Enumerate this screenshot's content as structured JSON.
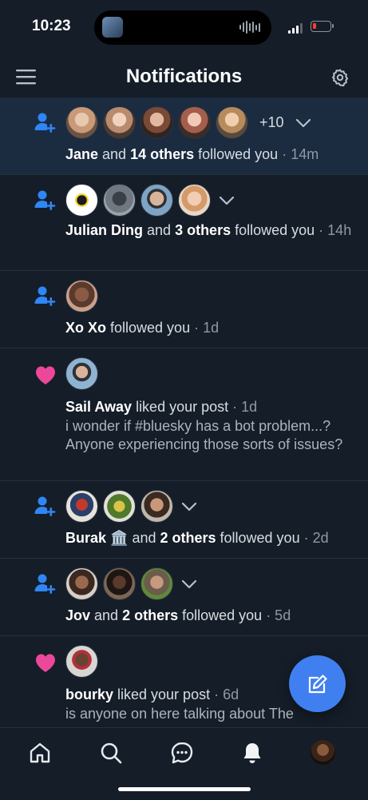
{
  "status_bar": {
    "time": "10:23"
  },
  "header": {
    "title": "Notifications"
  },
  "notifications": [
    {
      "type": "follow",
      "avatars": 5,
      "more": "+10",
      "actor": "Jane",
      "connector": " and ",
      "others": "14 others",
      "action": " followed you",
      "time": " · 14m"
    },
    {
      "type": "follow",
      "avatars": 4,
      "actor": "Julian Ding",
      "connector": " and ",
      "others": "3 others",
      "action": " followed you",
      "time": " · 14h"
    },
    {
      "type": "follow",
      "avatars": 1,
      "actor": "Xo Xo",
      "action": " followed you",
      "time": " · 1d"
    },
    {
      "type": "like",
      "avatars": 1,
      "actor": "Sail Away",
      "action": " liked your post",
      "time": " · 1d",
      "post": "i wonder if #bluesky has a bot problem...? Anyone experiencing those sorts of issues?"
    },
    {
      "type": "follow",
      "avatars": 3,
      "actor": "Burak 🏛️",
      "connector": " and ",
      "others": "2 others",
      "action": " followed you",
      "time": " · 2d"
    },
    {
      "type": "follow",
      "avatars": 3,
      "actor": "Jov",
      "connector": " and ",
      "others": "2 others",
      "action": " followed you",
      "time": " · 5d"
    },
    {
      "type": "like",
      "avatars": 1,
      "actor": "bourky",
      "action": " liked your post",
      "time": " · 6d",
      "post": "is anyone on here talking about The"
    }
  ],
  "icons": {
    "menu": "menu-icon",
    "settings": "gear-icon",
    "follow": "person-plus-icon",
    "like": "heart-icon",
    "compose": "pencil-icon",
    "home": "home-icon",
    "search": "search-icon",
    "chat": "chat-icon",
    "bell": "bell-icon"
  },
  "colors": {
    "accent": "#3f7ff0",
    "like": "#ec4899",
    "follow": "#2f86f6",
    "background": "#151d28",
    "highlight": "#1b2b40"
  }
}
